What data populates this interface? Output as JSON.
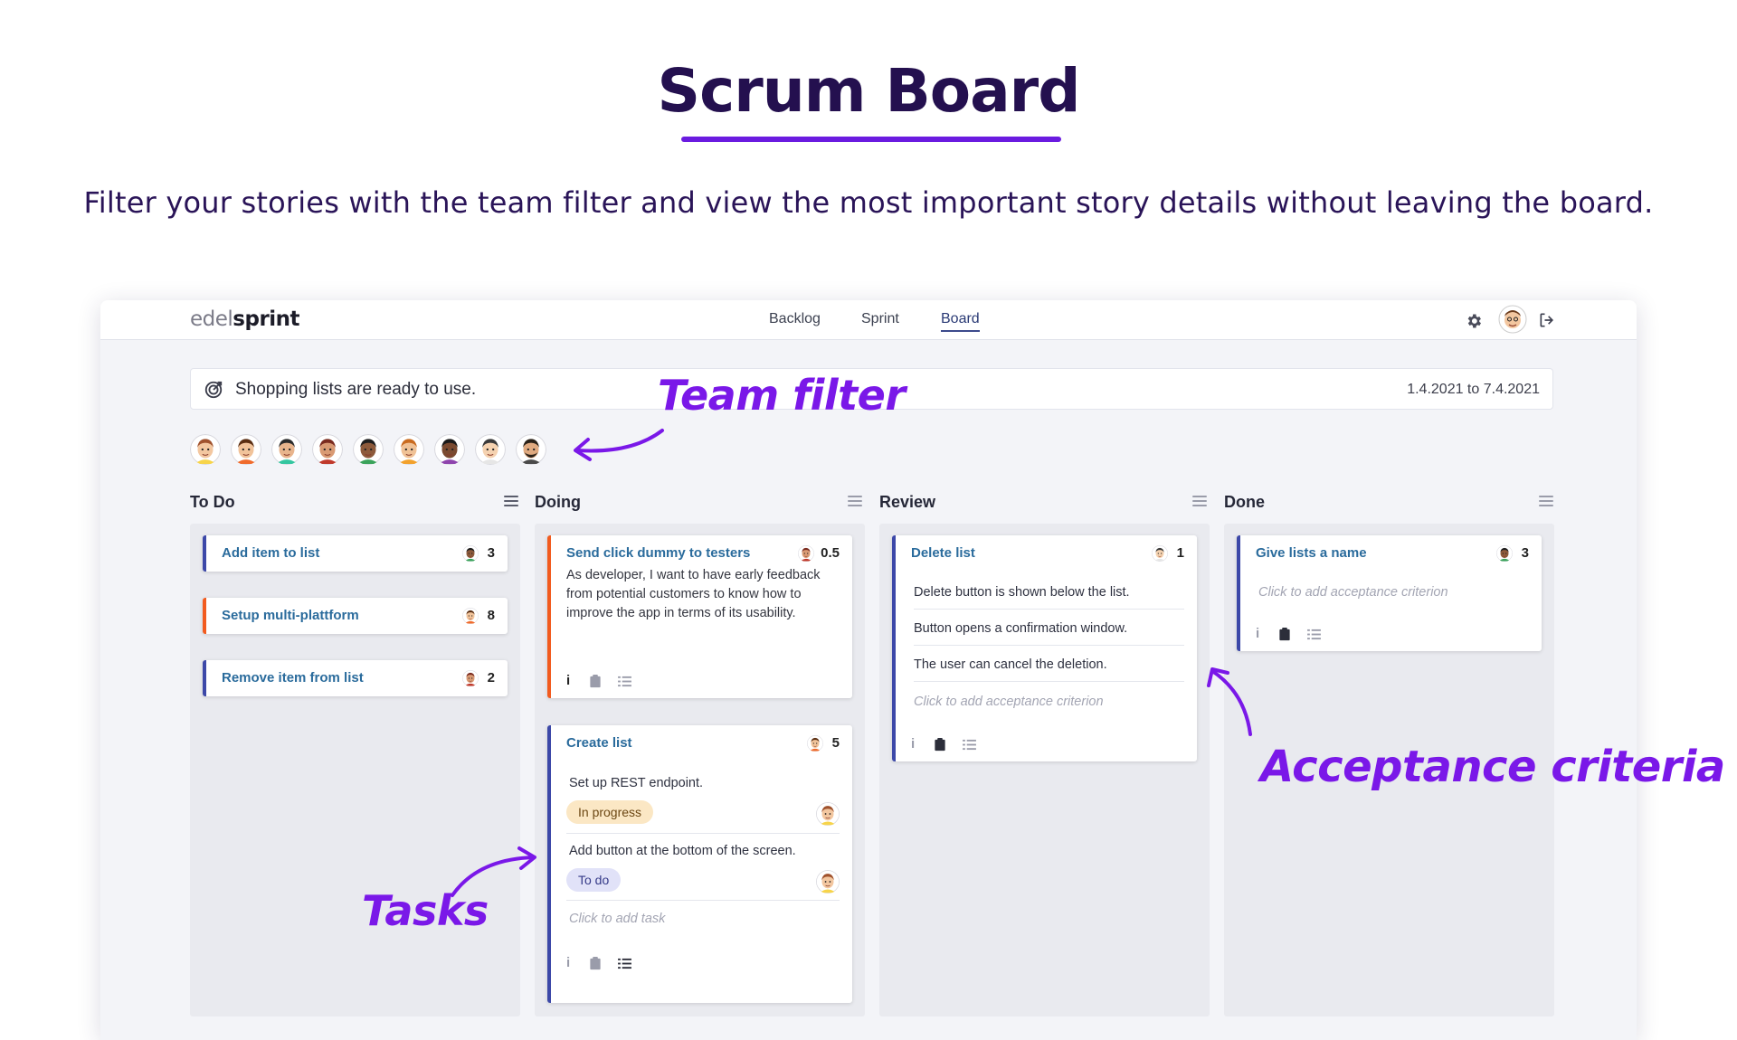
{
  "hero": {
    "title": "Scrum Board",
    "subtitle": "Filter your stories with the team filter and view the most important story details without leaving the board."
  },
  "app": {
    "logo_part1": "edel",
    "logo_part2": "sprint",
    "nav": [
      {
        "label": "Backlog"
      },
      {
        "label": "Sprint"
      },
      {
        "label": "Board",
        "active": true
      }
    ],
    "top_icons": [
      "gear-icon",
      "user-avatar",
      "logout-icon"
    ],
    "notice": {
      "icon": "goal-target-icon",
      "text": "Shopping lists are ready to use.",
      "date_range": "1.4.2021 to 7.4.2021"
    },
    "team_count": 9
  },
  "annotations": {
    "team_filter": "Team filter",
    "tasks": "Tasks",
    "acceptance": "Acceptance criteria"
  },
  "board": {
    "columns": [
      {
        "title": "To Do",
        "cards": [
          {
            "title": "Add item to list",
            "points": "3",
            "accent": "blue"
          },
          {
            "title": "Setup multi-plattform",
            "points": "8",
            "accent": "orange"
          },
          {
            "title": "Remove item from list",
            "points": "2",
            "accent": "blue"
          }
        ]
      },
      {
        "title": "Doing",
        "cards": [
          {
            "title": "Send click dummy to testers",
            "points": "0.5",
            "accent": "orange",
            "description": "As developer, I want to have early feedback from potential customers to know how to improve the app in terms of its usability."
          },
          {
            "title": "Create list",
            "points": "5",
            "accent": "blue",
            "tasks": [
              {
                "text": "Set up REST endpoint.",
                "status": "In progress"
              },
              {
                "text": "Add button at the bottom of the screen.",
                "status": "To do"
              }
            ],
            "add_task_placeholder": "Click to add task"
          }
        ]
      },
      {
        "title": "Review",
        "cards": [
          {
            "title": "Delete list",
            "points": "1",
            "accent": "blue",
            "criteria": [
              "Delete button is shown below the list.",
              "Button opens a confirmation window.",
              "The user can cancel the deletion."
            ],
            "add_criterion_placeholder": "Click to add acceptance criterion"
          }
        ]
      },
      {
        "title": "Done",
        "cards": [
          {
            "title": "Give lists a name",
            "points": "3",
            "accent": "blue",
            "add_criterion_placeholder": "Click to add acceptance criterion"
          }
        ]
      }
    ]
  },
  "colors": {
    "brand_purple": "#6a1be0",
    "annotation_purple": "#7a18e8",
    "card_blue_accent": "#3c48a8",
    "card_orange_accent": "#f25b1f",
    "title_blue": "#2a6b9c",
    "in_progress_bg": "#fbe7c4",
    "todo_bg": "#e1e2f8"
  }
}
